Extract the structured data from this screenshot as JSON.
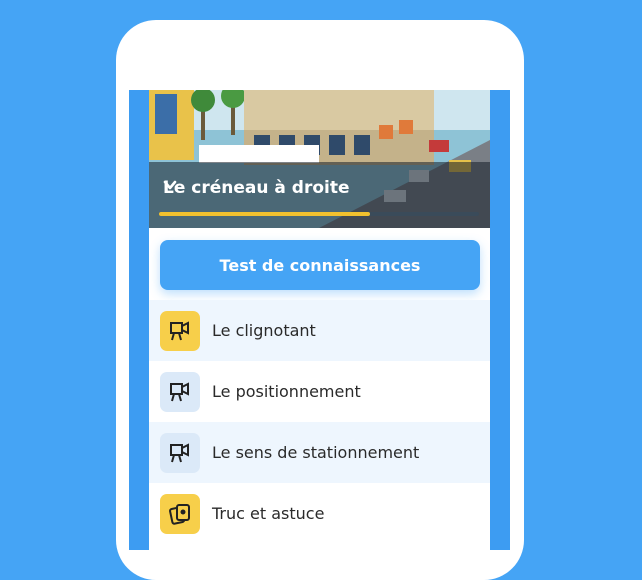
{
  "lesson": {
    "title": "Le créneau à droite",
    "progress": 0.66
  },
  "test_button": {
    "label": "Test de connaissances"
  },
  "items": [
    {
      "label": "Le clignotant",
      "icon": "video-camera-icon",
      "highlight": true
    },
    {
      "label": "Le positionnement",
      "icon": "video-camera-icon",
      "highlight": false
    },
    {
      "label": "Le sens de stationnement",
      "icon": "video-camera-icon",
      "highlight": false
    },
    {
      "label": "Truc et astuce",
      "icon": "cards-icon",
      "highlight": true
    }
  ],
  "colors": {
    "background": "#45a4f5",
    "accent": "#45a4f5",
    "highlight": "#f7cf4a",
    "progress": "#f2c12e"
  }
}
